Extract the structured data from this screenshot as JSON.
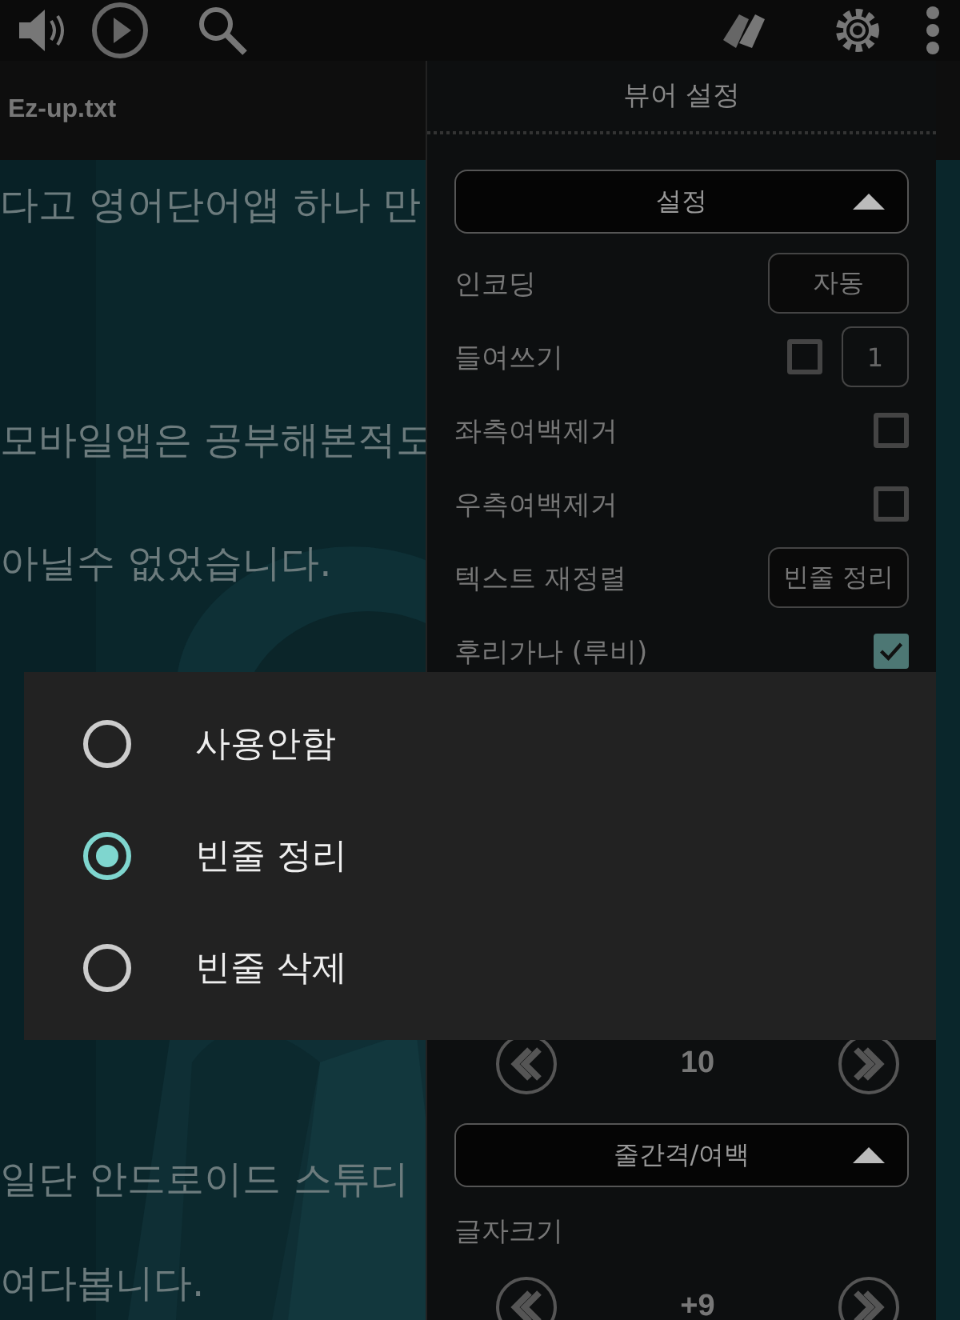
{
  "file_title": "Ez-up.txt",
  "reader_lines": [
    {
      "text": "다고 영어단어앱 하나 만"
    },
    {
      "text": "모바일앱은 공부해본적도"
    },
    {
      "text": "아닐수 없었습니다."
    },
    {
      "text": "일단 안드로이드 스튜디"
    },
    {
      "text": "여다봅니다."
    }
  ],
  "settings_panel": {
    "title": "뷰어 설정",
    "section": {
      "label": "설정",
      "expanded": true
    },
    "rows": [
      {
        "kind": "button",
        "label": "인코딩",
        "value": "자동"
      },
      {
        "kind": "checkbox_field",
        "label": "들여쓰기",
        "checked": false,
        "value": "1"
      },
      {
        "kind": "checkbox",
        "label": "좌측여백제거",
        "checked": false
      },
      {
        "kind": "checkbox",
        "label": "우측여백제거",
        "checked": false
      },
      {
        "kind": "button",
        "label": "텍스트 재정렬",
        "value": "빈줄 정리"
      },
      {
        "kind": "checkbox",
        "label": "후리가나 (루비)",
        "checked": true
      }
    ],
    "stepper": {
      "value": "10"
    },
    "section2": {
      "label": "줄간격/여백",
      "expanded": true
    },
    "font_size": {
      "label": "글자크기",
      "value": "+9"
    }
  },
  "dialog": {
    "options": [
      {
        "label": "사용안함",
        "selected": false
      },
      {
        "label": "빈줄 정리",
        "selected": true
      },
      {
        "label": "빈줄 삭제",
        "selected": false
      }
    ]
  }
}
